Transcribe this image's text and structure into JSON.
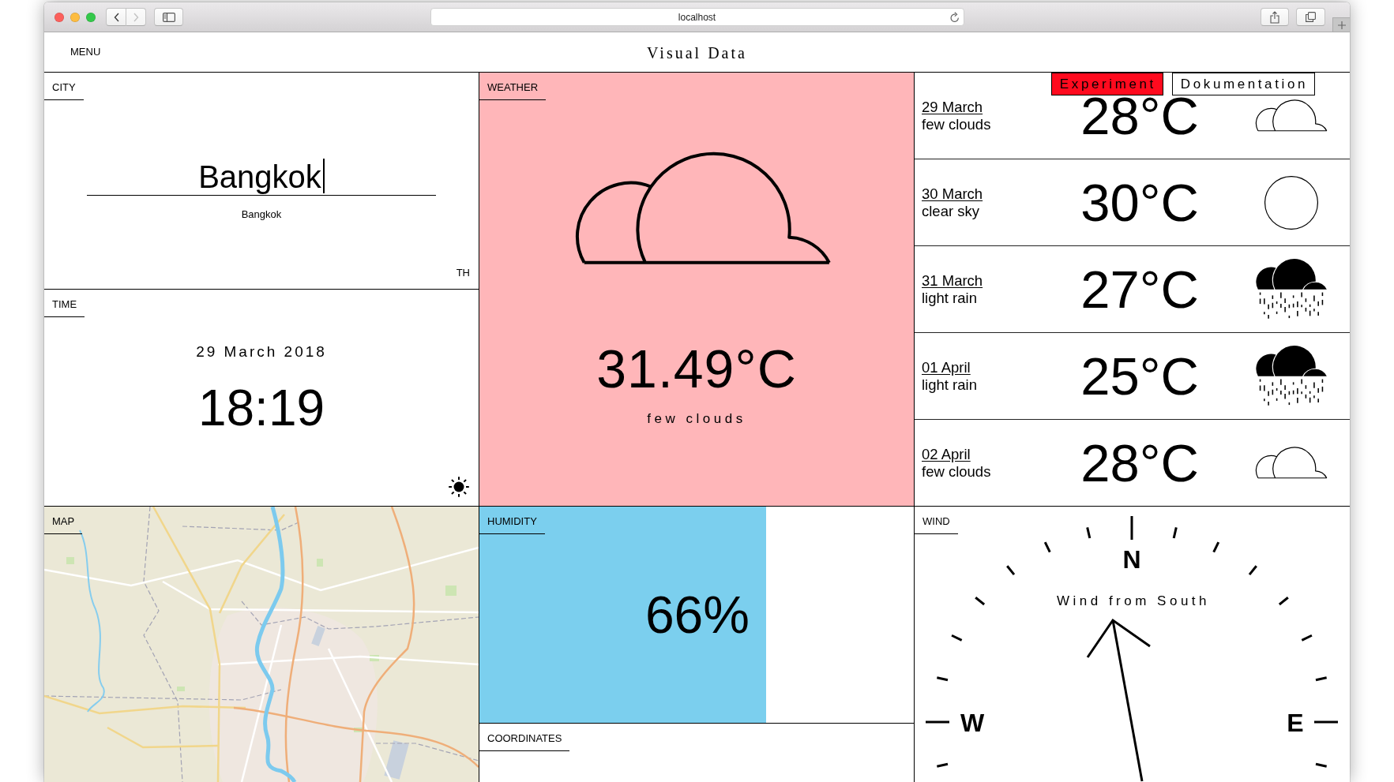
{
  "browser": {
    "url": "localhost",
    "nav": [
      {
        "kind": "back",
        "disabled": false
      },
      {
        "kind": "forward",
        "disabled": true
      }
    ]
  },
  "header": {
    "menu": "MENU",
    "title": "Visual Data"
  },
  "nav_buttons": [
    {
      "label": "Experiment",
      "selected": true
    },
    {
      "label": "Dokumentation",
      "selected": false
    }
  ],
  "city": {
    "label": "CITY",
    "input": {
      "value": "Bangkok",
      "focused": true
    },
    "name": "Bangkok",
    "country": "TH"
  },
  "time": {
    "label": "TIME",
    "date": "29 March 2018",
    "clock": "18:19",
    "daytime": true
  },
  "weather": {
    "label": "WEATHER",
    "kind": "clouds",
    "temperature": "31.49°C",
    "description": "few clouds"
  },
  "forecast": [
    {
      "date": "29 March",
      "description": "few clouds",
      "temperature": "28°C",
      "kind": "clouds"
    },
    {
      "date": "30 March",
      "description": "clear sky",
      "temperature": "30°C",
      "kind": "clear"
    },
    {
      "date": "31 March",
      "description": "light rain",
      "temperature": "27°C",
      "kind": "rain"
    },
    {
      "date": "01 April",
      "description": "light rain",
      "temperature": "25°C",
      "kind": "rain"
    },
    {
      "date": "02 April",
      "description": "few clouds",
      "temperature": "28°C",
      "kind": "clouds"
    }
  ],
  "map": {
    "label": "MAP"
  },
  "humidity": {
    "label": "HUMIDITY",
    "value": "66%",
    "level": 0.66
  },
  "coordinates": {
    "label": "COORDINATES"
  },
  "wind": {
    "label": "WIND",
    "compass": [
      {
        "kind": "north",
        "label": "N"
      },
      {
        "kind": "west",
        "label": "W"
      },
      {
        "kind": "east",
        "label": "E"
      }
    ],
    "direction": "Wind from South"
  }
}
